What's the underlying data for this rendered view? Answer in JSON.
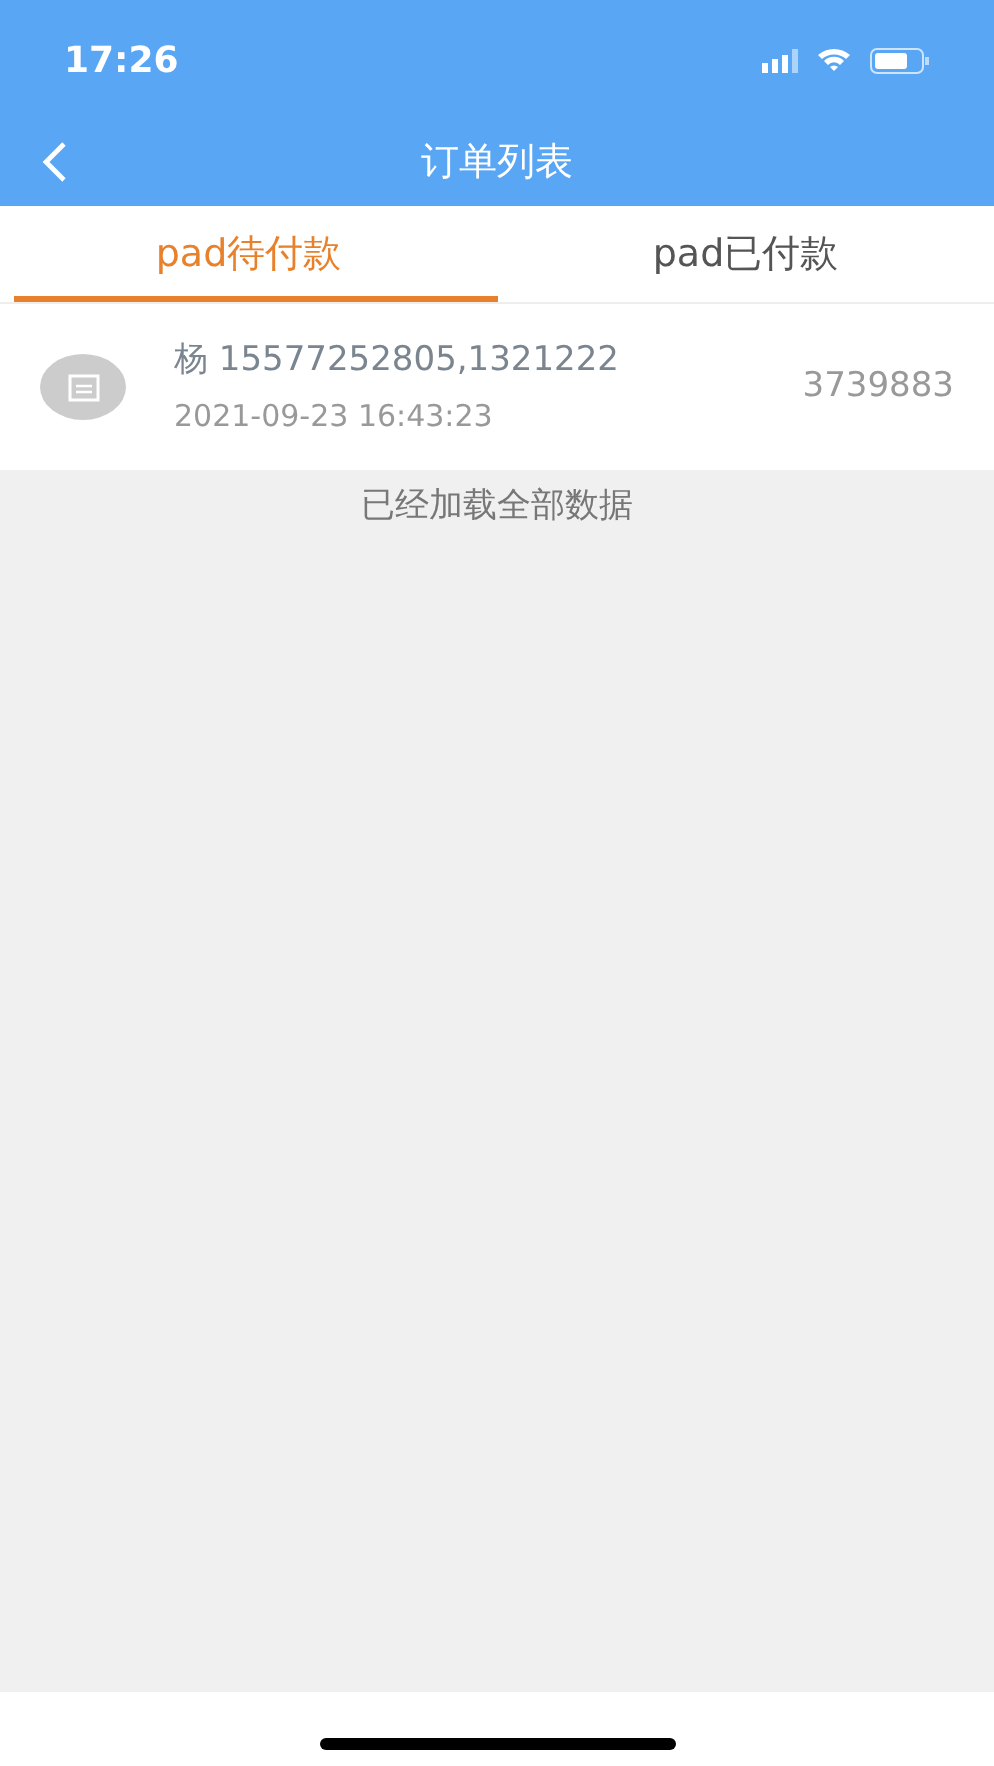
{
  "status_bar": {
    "time": "17:26"
  },
  "nav": {
    "title": "订单列表"
  },
  "tabs": [
    {
      "label": "pad待付款",
      "selected": true
    },
    {
      "label": "pad已付款",
      "selected": false
    }
  ],
  "orders": [
    {
      "name": "杨 15577252805,1321222",
      "time": "2021-09-23 16:43:23",
      "amount": "3739883"
    }
  ],
  "footer_note": "已经加载全部数据"
}
